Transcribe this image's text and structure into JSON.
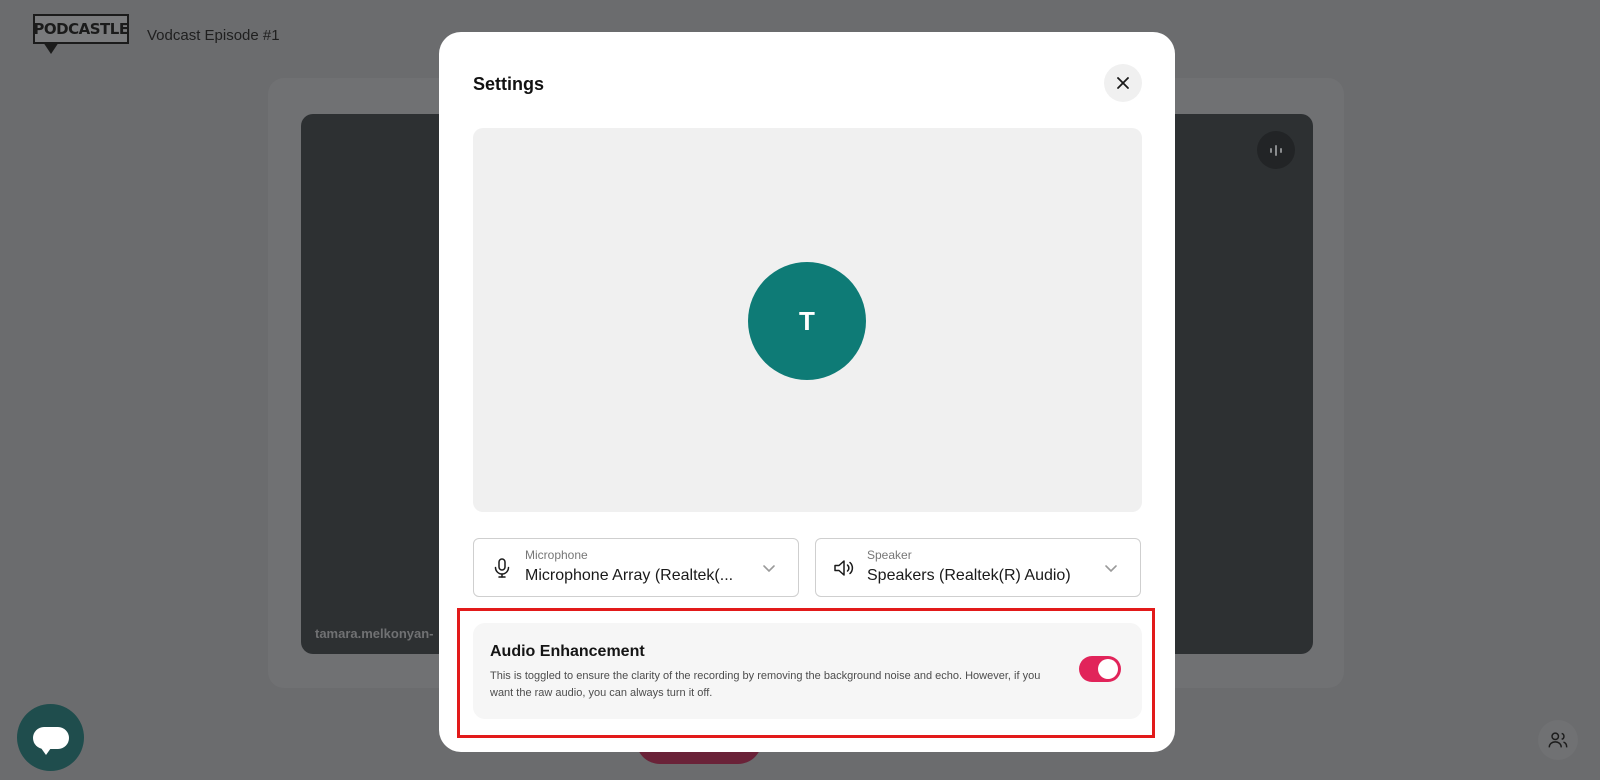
{
  "app": {
    "logo_text": "PODCASTLE",
    "project_title": "Vodcast Episode #1"
  },
  "tile": {
    "participant_name": "tamara.melkonyan-"
  },
  "settings_modal": {
    "title": "Settings",
    "avatar_initial": "T",
    "microphone": {
      "label": "Microphone",
      "value": "Microphone Array (Realtek(..."
    },
    "speaker": {
      "label": "Speaker",
      "value": "Speakers (Realtek(R) Audio)"
    },
    "audio_enhancement": {
      "title": "Audio Enhancement",
      "description": "This is toggled to ensure the clarity of the recording by removing the background noise and echo. However, if you want the raw audio, you can always turn it off.",
      "enabled": true
    }
  },
  "colors": {
    "avatar": "#0e7b76",
    "toggle_on": "#e1245a",
    "highlight": "#e21a1a"
  }
}
